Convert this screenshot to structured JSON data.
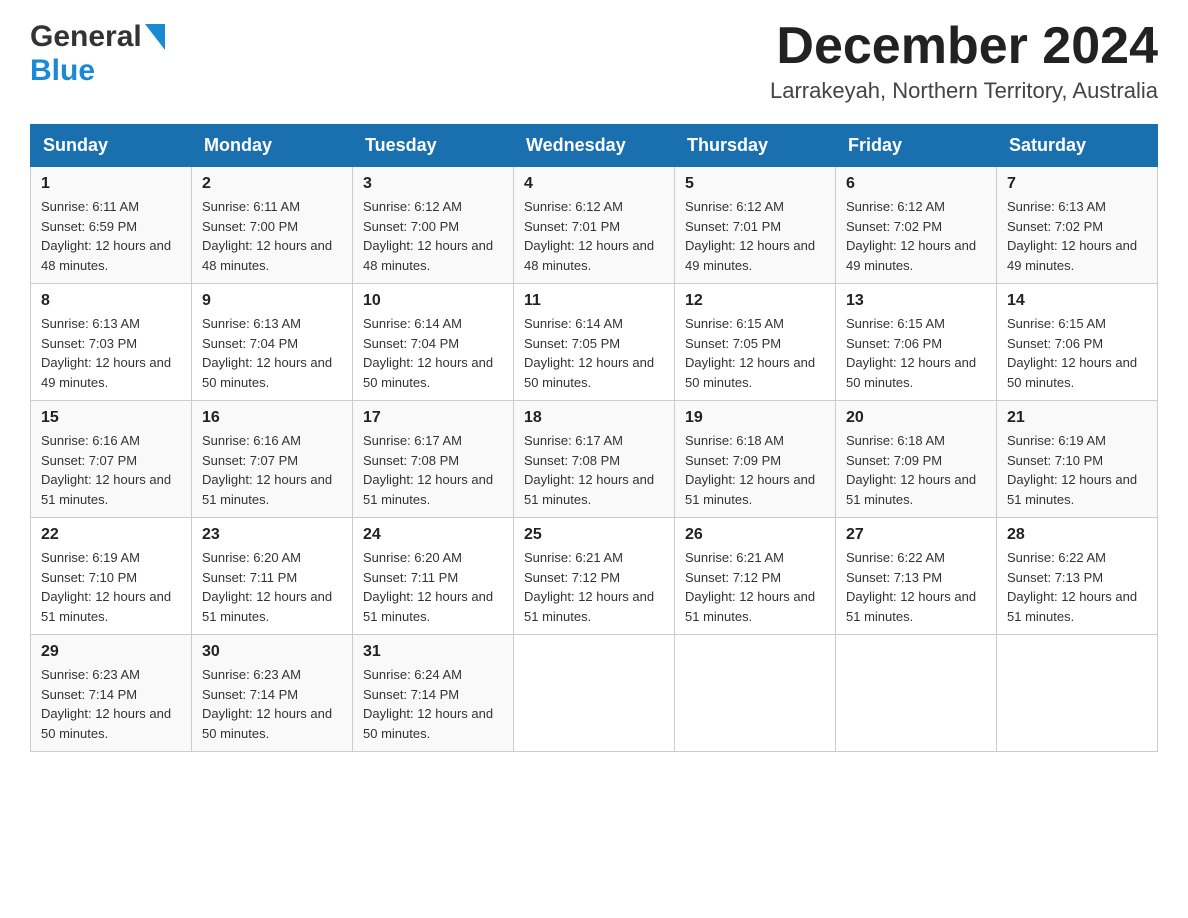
{
  "header": {
    "logo_general": "General",
    "logo_blue": "Blue",
    "month_year": "December 2024",
    "location": "Larrakeyah, Northern Territory, Australia"
  },
  "calendar": {
    "days_of_week": [
      "Sunday",
      "Monday",
      "Tuesday",
      "Wednesday",
      "Thursday",
      "Friday",
      "Saturday"
    ],
    "weeks": [
      [
        {
          "day": "1",
          "sunrise": "Sunrise: 6:11 AM",
          "sunset": "Sunset: 6:59 PM",
          "daylight": "Daylight: 12 hours and 48 minutes."
        },
        {
          "day": "2",
          "sunrise": "Sunrise: 6:11 AM",
          "sunset": "Sunset: 7:00 PM",
          "daylight": "Daylight: 12 hours and 48 minutes."
        },
        {
          "day": "3",
          "sunrise": "Sunrise: 6:12 AM",
          "sunset": "Sunset: 7:00 PM",
          "daylight": "Daylight: 12 hours and 48 minutes."
        },
        {
          "day": "4",
          "sunrise": "Sunrise: 6:12 AM",
          "sunset": "Sunset: 7:01 PM",
          "daylight": "Daylight: 12 hours and 48 minutes."
        },
        {
          "day": "5",
          "sunrise": "Sunrise: 6:12 AM",
          "sunset": "Sunset: 7:01 PM",
          "daylight": "Daylight: 12 hours and 49 minutes."
        },
        {
          "day": "6",
          "sunrise": "Sunrise: 6:12 AM",
          "sunset": "Sunset: 7:02 PM",
          "daylight": "Daylight: 12 hours and 49 minutes."
        },
        {
          "day": "7",
          "sunrise": "Sunrise: 6:13 AM",
          "sunset": "Sunset: 7:02 PM",
          "daylight": "Daylight: 12 hours and 49 minutes."
        }
      ],
      [
        {
          "day": "8",
          "sunrise": "Sunrise: 6:13 AM",
          "sunset": "Sunset: 7:03 PM",
          "daylight": "Daylight: 12 hours and 49 minutes."
        },
        {
          "day": "9",
          "sunrise": "Sunrise: 6:13 AM",
          "sunset": "Sunset: 7:04 PM",
          "daylight": "Daylight: 12 hours and 50 minutes."
        },
        {
          "day": "10",
          "sunrise": "Sunrise: 6:14 AM",
          "sunset": "Sunset: 7:04 PM",
          "daylight": "Daylight: 12 hours and 50 minutes."
        },
        {
          "day": "11",
          "sunrise": "Sunrise: 6:14 AM",
          "sunset": "Sunset: 7:05 PM",
          "daylight": "Daylight: 12 hours and 50 minutes."
        },
        {
          "day": "12",
          "sunrise": "Sunrise: 6:15 AM",
          "sunset": "Sunset: 7:05 PM",
          "daylight": "Daylight: 12 hours and 50 minutes."
        },
        {
          "day": "13",
          "sunrise": "Sunrise: 6:15 AM",
          "sunset": "Sunset: 7:06 PM",
          "daylight": "Daylight: 12 hours and 50 minutes."
        },
        {
          "day": "14",
          "sunrise": "Sunrise: 6:15 AM",
          "sunset": "Sunset: 7:06 PM",
          "daylight": "Daylight: 12 hours and 50 minutes."
        }
      ],
      [
        {
          "day": "15",
          "sunrise": "Sunrise: 6:16 AM",
          "sunset": "Sunset: 7:07 PM",
          "daylight": "Daylight: 12 hours and 51 minutes."
        },
        {
          "day": "16",
          "sunrise": "Sunrise: 6:16 AM",
          "sunset": "Sunset: 7:07 PM",
          "daylight": "Daylight: 12 hours and 51 minutes."
        },
        {
          "day": "17",
          "sunrise": "Sunrise: 6:17 AM",
          "sunset": "Sunset: 7:08 PM",
          "daylight": "Daylight: 12 hours and 51 minutes."
        },
        {
          "day": "18",
          "sunrise": "Sunrise: 6:17 AM",
          "sunset": "Sunset: 7:08 PM",
          "daylight": "Daylight: 12 hours and 51 minutes."
        },
        {
          "day": "19",
          "sunrise": "Sunrise: 6:18 AM",
          "sunset": "Sunset: 7:09 PM",
          "daylight": "Daylight: 12 hours and 51 minutes."
        },
        {
          "day": "20",
          "sunrise": "Sunrise: 6:18 AM",
          "sunset": "Sunset: 7:09 PM",
          "daylight": "Daylight: 12 hours and 51 minutes."
        },
        {
          "day": "21",
          "sunrise": "Sunrise: 6:19 AM",
          "sunset": "Sunset: 7:10 PM",
          "daylight": "Daylight: 12 hours and 51 minutes."
        }
      ],
      [
        {
          "day": "22",
          "sunrise": "Sunrise: 6:19 AM",
          "sunset": "Sunset: 7:10 PM",
          "daylight": "Daylight: 12 hours and 51 minutes."
        },
        {
          "day": "23",
          "sunrise": "Sunrise: 6:20 AM",
          "sunset": "Sunset: 7:11 PM",
          "daylight": "Daylight: 12 hours and 51 minutes."
        },
        {
          "day": "24",
          "sunrise": "Sunrise: 6:20 AM",
          "sunset": "Sunset: 7:11 PM",
          "daylight": "Daylight: 12 hours and 51 minutes."
        },
        {
          "day": "25",
          "sunrise": "Sunrise: 6:21 AM",
          "sunset": "Sunset: 7:12 PM",
          "daylight": "Daylight: 12 hours and 51 minutes."
        },
        {
          "day": "26",
          "sunrise": "Sunrise: 6:21 AM",
          "sunset": "Sunset: 7:12 PM",
          "daylight": "Daylight: 12 hours and 51 minutes."
        },
        {
          "day": "27",
          "sunrise": "Sunrise: 6:22 AM",
          "sunset": "Sunset: 7:13 PM",
          "daylight": "Daylight: 12 hours and 51 minutes."
        },
        {
          "day": "28",
          "sunrise": "Sunrise: 6:22 AM",
          "sunset": "Sunset: 7:13 PM",
          "daylight": "Daylight: 12 hours and 51 minutes."
        }
      ],
      [
        {
          "day": "29",
          "sunrise": "Sunrise: 6:23 AM",
          "sunset": "Sunset: 7:14 PM",
          "daylight": "Daylight: 12 hours and 50 minutes."
        },
        {
          "day": "30",
          "sunrise": "Sunrise: 6:23 AM",
          "sunset": "Sunset: 7:14 PM",
          "daylight": "Daylight: 12 hours and 50 minutes."
        },
        {
          "day": "31",
          "sunrise": "Sunrise: 6:24 AM",
          "sunset": "Sunset: 7:14 PM",
          "daylight": "Daylight: 12 hours and 50 minutes."
        },
        null,
        null,
        null,
        null
      ]
    ]
  }
}
